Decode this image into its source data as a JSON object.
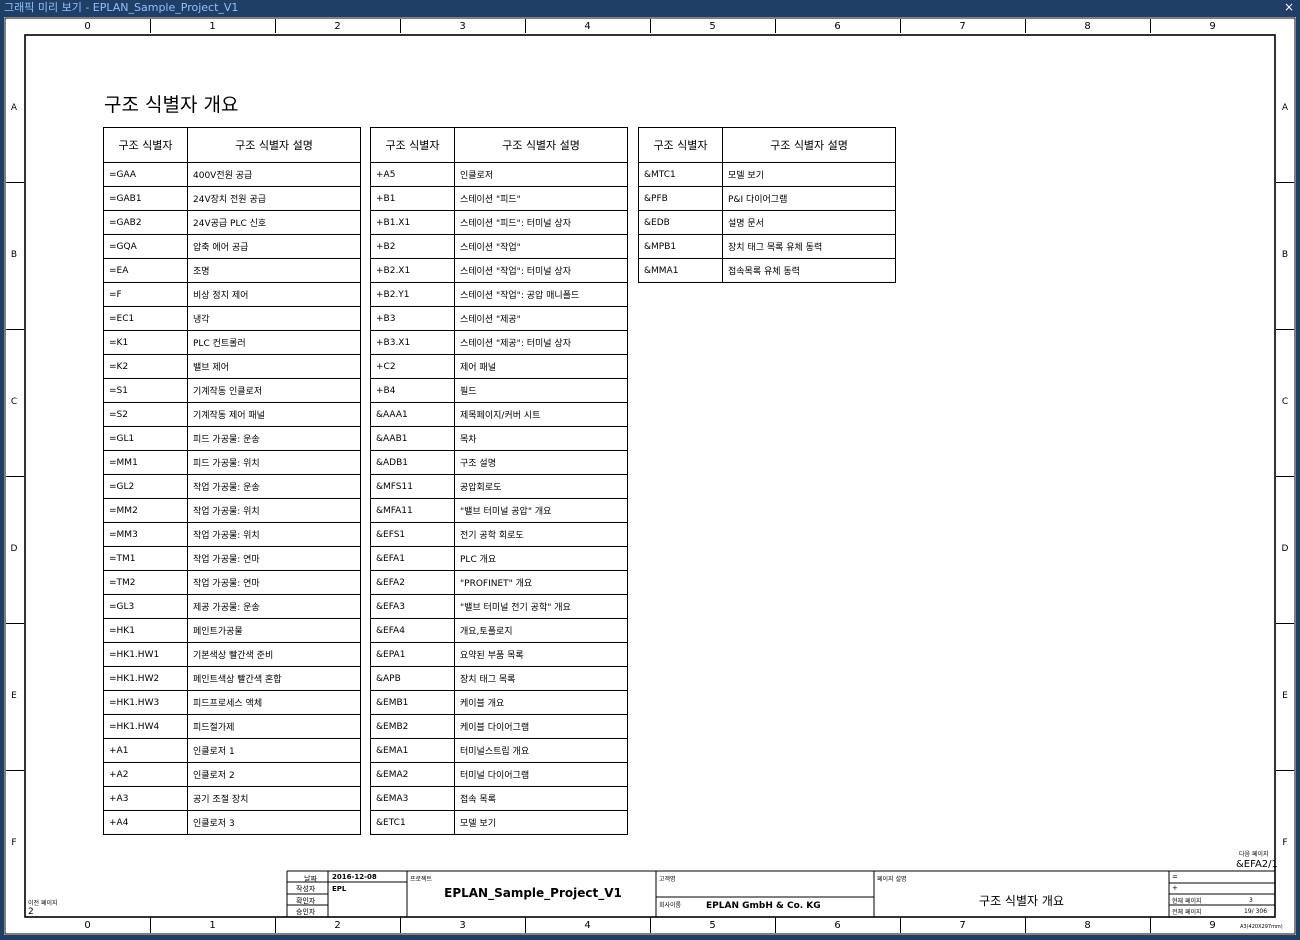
{
  "window": {
    "title": "그래픽 미리 보기 - EPLAN_Sample_Project_V1",
    "close_icon": "×"
  },
  "frame": {
    "columns": [
      "0",
      "1",
      "2",
      "3",
      "4",
      "5",
      "6",
      "7",
      "8",
      "9"
    ],
    "rows": [
      "A",
      "B",
      "C",
      "D",
      "E",
      "F"
    ]
  },
  "page": {
    "title": "구조 식별자 개요",
    "header_id": "구조 식별자",
    "header_desc": "구조 식별자 설명"
  },
  "tables": [
    {
      "rows": [
        [
          "=GAA",
          "400V전원 공급"
        ],
        [
          "=GAB1",
          "24V장치 전원 공급"
        ],
        [
          "=GAB2",
          "24V공급 PLC 신호"
        ],
        [
          "=GQA",
          "압축 에어 공급"
        ],
        [
          "=EA",
          "조명"
        ],
        [
          "=F",
          "비상 정지 제어"
        ],
        [
          "=EC1",
          "냉각"
        ],
        [
          "=K1",
          "PLC 컨트롤러"
        ],
        [
          "=K2",
          "밸브 제어"
        ],
        [
          "=S1",
          "기계작동 인클로저"
        ],
        [
          "=S2",
          "기계작동 제어 패널"
        ],
        [
          "=GL1",
          "피드 가공물: 운송"
        ],
        [
          "=MM1",
          "피드 가공물: 위치"
        ],
        [
          "=GL2",
          "작업 가공물: 운송"
        ],
        [
          "=MM2",
          "작업 가공물: 위치"
        ],
        [
          "=MM3",
          "작업 가공물: 위치"
        ],
        [
          "=TM1",
          "작업 가공물: 연마"
        ],
        [
          "=TM2",
          "작업 가공물: 연마"
        ],
        [
          "=GL3",
          "제공 가공물: 운송"
        ],
        [
          "=HK1",
          "페인트가공물"
        ],
        [
          "=HK1.HW1",
          "기본색상 빨간색 준비"
        ],
        [
          "=HK1.HW2",
          "페인트색상 빨간색 혼합"
        ],
        [
          "=HK1.HW3",
          "피드프로세스 액체"
        ],
        [
          "=HK1.HW4",
          "피드절가제"
        ],
        [
          "+A1",
          "인클로저 1"
        ],
        [
          "+A2",
          "인클로저 2"
        ],
        [
          "+A3",
          "공기 조절 장치"
        ],
        [
          "+A4",
          "인클로저 3"
        ]
      ]
    },
    {
      "rows": [
        [
          "+A5",
          "인클로저"
        ],
        [
          "+B1",
          "스테이션 \"피드\""
        ],
        [
          "+B1.X1",
          "스테이션 \"피드\": 터미널 상자"
        ],
        [
          "+B2",
          "스테이션 \"작업\""
        ],
        [
          "+B2.X1",
          "스테이션 \"작업\": 터미널 상자"
        ],
        [
          "+B2.Y1",
          "스테이션 \"작업\": 공압 매니폴드"
        ],
        [
          "+B3",
          "스테이션 \"제공\""
        ],
        [
          "+B3.X1",
          "스테이션 \"제공\": 터미널 상자"
        ],
        [
          "+C2",
          "제어 패널"
        ],
        [
          "+B4",
          "필드"
        ],
        [
          "&AAA1",
          "제목페이지/커버 시트"
        ],
        [
          "&AAB1",
          "목차"
        ],
        [
          "&ADB1",
          "구조 설명"
        ],
        [
          "&MFS11",
          "공압회로도"
        ],
        [
          "&MFA11",
          "\"밸브 터미널 공압\" 개요"
        ],
        [
          "&EFS1",
          "전기 공학 회로도"
        ],
        [
          "&EFA1",
          "PLC 개요"
        ],
        [
          "&EFA2",
          "\"PROFINET\" 개요"
        ],
        [
          "&EFA3",
          "\"밸브 터미널 전기 공학\" 개요"
        ],
        [
          "&EFA4",
          "개요,토폴로지"
        ],
        [
          "&EPA1",
          "요약된 부품 목록"
        ],
        [
          "&APB",
          "장치 태그 목록"
        ],
        [
          "&EMB1",
          "케이블 개요"
        ],
        [
          "&EMB2",
          "케이블 다이어그램"
        ],
        [
          "&EMA1",
          "터미널스트립 개요"
        ],
        [
          "&EMA2",
          "터미널 다이어그램"
        ],
        [
          "&EMA3",
          "접속 목록"
        ],
        [
          "&ETC1",
          "모델 보기"
        ]
      ]
    },
    {
      "rows": [
        [
          "&MTC1",
          "모델 보기"
        ],
        [
          "&PFB",
          "P&I 다이어그램"
        ],
        [
          "&EDB",
          "설명 문서"
        ],
        [
          "&MPB1",
          "장치 태그 목록 유체 동력"
        ],
        [
          "&MMA1",
          "접속목록 유체 동력"
        ]
      ]
    }
  ],
  "title_block": {
    "next_page_label": "다음 페이지",
    "next_page_value": "&EFA2/1",
    "prev_page_label": "이전 페이지",
    "prev_page_value": "2",
    "date_label": "날짜",
    "date_value": "2016-12-08",
    "author_label": "작성자",
    "author_value": "EPL",
    "checked_label": "확인자",
    "approved_label": "승인자",
    "project_label": "프로젝트",
    "project_value": "EPLAN_Sample_Project_V1",
    "customer_label": "고객명",
    "company_label": "회사이름",
    "company_value": "EPLAN GmbH & Co. KG",
    "desc_label": "페이지 설명",
    "desc_value": "구조 식별자 개요",
    "eq_label": "=",
    "plus_label": "+",
    "current_page_label": "현재 페이지",
    "current_page_value": "3",
    "total_page_label": "전체 페이지",
    "total_page_value": "19/ 306",
    "format": "A3(420X297mm)"
  }
}
